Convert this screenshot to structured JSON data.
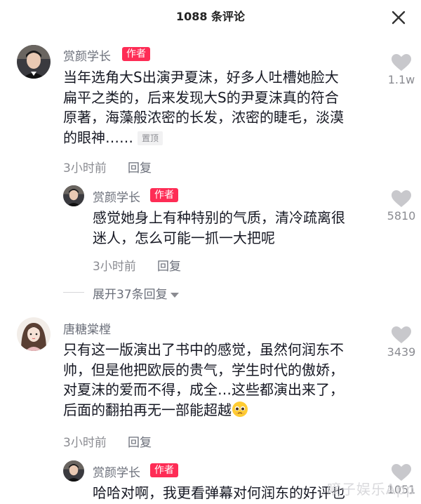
{
  "header": {
    "title": "1088 条评论"
  },
  "comments": [
    {
      "username": "赏颜学长",
      "badge": "作者",
      "lines": [
        "当年选角大S出演尹夏沫，好多人吐槽她脸大",
        "扁平之类的，后来发现大S的尹夏沫真的符合",
        "原著，海藻般浓密的长发，浓密的睫毛，淡漠",
        "的眼神……"
      ],
      "pinned": "置顶",
      "time": "3小时前",
      "reply": "回复",
      "likes": "1.1w"
    },
    {
      "username": "赏颜学长",
      "badge": "作者",
      "lines": [
        "感觉她身上有种特别的气质，清冷疏离很",
        "迷人，怎么可能一抓一大把呢"
      ],
      "time": "3小时前",
      "reply": "回复",
      "likes": "5810"
    },
    {
      "username": "唐糖棠樘",
      "lines": [
        "只有这一版演出了书中的感觉，虽然何润东不",
        "帅，但是他把欧辰的贵气，学生时代的傲娇，",
        "对夏沫的爱而不得，成全…这些都演出来了，",
        "后面的翻拍再无一部能超越"
      ],
      "emoji": "pleading-face-emoji",
      "time": "3小时前",
      "reply": "回复",
      "likes": "3439"
    },
    {
      "username": "赏颜学长",
      "badge": "作者",
      "lines": [
        "哈哈对啊，我更看弹幕对何润东的好评也"
      ],
      "likes": "1051"
    }
  ],
  "expand": {
    "label": "展开37条回复"
  },
  "watermark": "嘀子娱乐App",
  "colors": {
    "accent": "#fe2c55",
    "text": "#161823",
    "secondary": "#8a8b91"
  },
  "icons": {
    "close": "close-icon",
    "like": "heart-icon",
    "expand": "chevron-down-icon"
  }
}
